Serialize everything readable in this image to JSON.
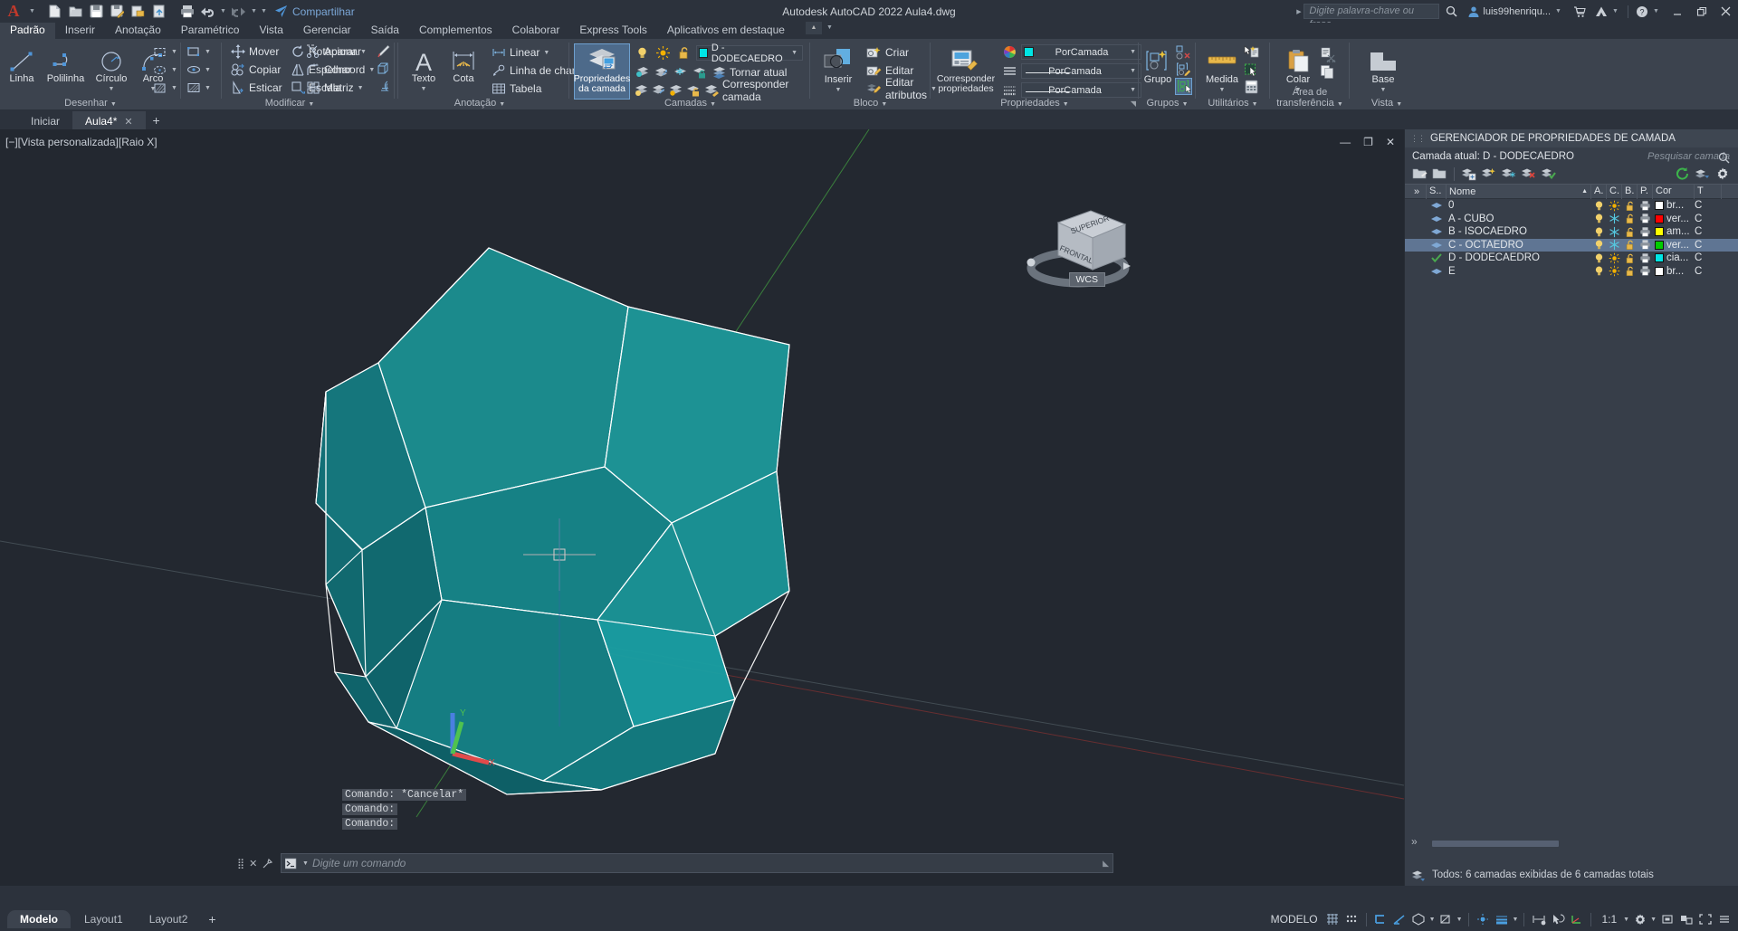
{
  "titlebar": {
    "app_logo": "autodesk-a-logo",
    "quick_access": [
      "new-icon",
      "open-icon",
      "save-icon",
      "save-as-icon",
      "plot-preview-icon",
      "publish-icon",
      "print-icon",
      "undo-icon",
      "redo-icon",
      "customize-icon"
    ],
    "share_label": "Compartilhar",
    "title": "Autodesk AutoCAD 2022    Aula4.dwg",
    "search_placeholder": "Digite palavra-chave ou frase",
    "user_label": "luis99henriqu...",
    "window_buttons": [
      "minimize",
      "restore",
      "close"
    ]
  },
  "ribbon_tabs": [
    {
      "label": "Padrão",
      "active": true
    },
    {
      "label": "Inserir",
      "active": false
    },
    {
      "label": "Anotação",
      "active": false
    },
    {
      "label": "Paramétrico",
      "active": false
    },
    {
      "label": "Vista",
      "active": false
    },
    {
      "label": "Gerenciar",
      "active": false
    },
    {
      "label": "Saída",
      "active": false
    },
    {
      "label": "Complementos",
      "active": false
    },
    {
      "label": "Colaborar",
      "active": false
    },
    {
      "label": "Express Tools",
      "active": false
    },
    {
      "label": "Aplicativos em destaque",
      "active": false
    }
  ],
  "ribbon": {
    "desenhar": {
      "title": "Desenhar",
      "big": [
        {
          "label": "Linha",
          "icon": "line-icon"
        },
        {
          "label": "Polilinha",
          "icon": "polyline-icon"
        },
        {
          "label": "Círculo",
          "icon": "circle-icon",
          "dropdown": true
        },
        {
          "label": "Arco",
          "icon": "arc-icon",
          "dropdown": true
        }
      ],
      "small": [
        "rectangle-icon",
        "ellipse-icon",
        "hatch-icon"
      ]
    },
    "modificar": {
      "title": "Modificar",
      "col1": [
        {
          "label": "Mover",
          "icon": "move-icon"
        },
        {
          "label": "Copiar",
          "icon": "copy-icon"
        },
        {
          "label": "Esticar",
          "icon": "stretch-icon"
        }
      ],
      "col2": [
        {
          "label": "Rotacionar",
          "icon": "rotate-icon"
        },
        {
          "label": "Espelhar",
          "icon": "mirror-icon"
        },
        {
          "label": "Escala",
          "icon": "scale-icon"
        }
      ],
      "col3": [
        {
          "label": "Aparar",
          "icon": "trim-icon",
          "dropdown": true
        },
        {
          "label": "Concord",
          "icon": "fillet-icon",
          "dropdown": true
        },
        {
          "label": "Matriz",
          "icon": "array-icon",
          "dropdown": true
        }
      ],
      "col4": [
        "erase-icon",
        "explode-icon",
        "offset-icon"
      ]
    },
    "anotacao": {
      "title": "Anotação",
      "big": [
        {
          "label": "Texto",
          "icon": "text-icon",
          "dropdown": true
        },
        {
          "label": "Cota",
          "icon": "dimension-icon"
        }
      ],
      "rows": [
        {
          "label": "Linear",
          "icon": "linear-dim-icon",
          "dropdown": true
        },
        {
          "label": "Linha de chamada",
          "icon": "leader-icon",
          "dropdown": true
        },
        {
          "label": "Tabela",
          "icon": "table-icon"
        }
      ]
    },
    "camadas": {
      "title": "Camadas",
      "big": {
        "label_line1": "Propriedades",
        "label_line2": "da camada",
        "icon": "layer-properties-icon",
        "active": true
      },
      "layer_combo": {
        "value": "D - DODECAEDRO",
        "color": "#00e5e5"
      },
      "state_icons": [
        "bulb-on-icon",
        "sun-icon",
        "unlock-icon"
      ],
      "row2_icons": [
        "layer-isolate-icon",
        "layer-unisolate-icon",
        "layer-freeze-icon",
        "layer-lock-icon"
      ],
      "row3_icons": [
        "layer-off-icon",
        "layer-turn-all-on-icon",
        "layer-thaw-icon",
        "layer-unlock-icon"
      ],
      "make_current": "Tornar atual",
      "match_layer": "Corresponder camada"
    },
    "bloco": {
      "title": "Bloco",
      "big": {
        "label": "Inserir",
        "icon": "insert-block-icon",
        "dropdown": true
      },
      "rows": [
        {
          "label": "Criar",
          "icon": "create-block-icon"
        },
        {
          "label": "Editar",
          "icon": "edit-block-icon"
        },
        {
          "label": "Editar atributos",
          "icon": "edit-attributes-icon",
          "dropdown": true
        }
      ]
    },
    "propriedades": {
      "title": "Propriedades",
      "big": {
        "label_line1": "Corresponder",
        "label_line2": "propriedades",
        "icon": "match-properties-icon"
      },
      "combos": [
        {
          "value": "PorCamada",
          "icon": "color-wheel-icon",
          "swatch": "#00e5e5"
        },
        {
          "value": "PorCamada",
          "icon": "linetype-icon",
          "line": true
        },
        {
          "value": "PorCamada",
          "icon": "lineweight-icon",
          "line": true
        }
      ]
    },
    "grupos": {
      "title": "Grupos",
      "big": {
        "label": "Grupo",
        "icon": "group-icon",
        "dropdown": true
      },
      "small": [
        "ungroup-icon",
        "edit-group-icon",
        "group-selection-on-icon"
      ]
    },
    "utilitarios": {
      "title": "Utilitários",
      "big": {
        "label": "Medida",
        "icon": "measure-icon",
        "dropdown": true
      },
      "small": [
        "quick-select-icon",
        "quick-calc-area-icon",
        "calculator-icon"
      ]
    },
    "area_transferencia": {
      "title": "Área de transferência",
      "big": {
        "label": "Colar",
        "icon": "paste-icon",
        "dropdown": true
      },
      "small": [
        "cut-icon",
        "copy-clip-icon"
      ]
    },
    "vista": {
      "title": "Vista",
      "big": {
        "label": "Base",
        "icon": "base-view-icon",
        "dropdown": true
      }
    }
  },
  "doctabs": [
    {
      "label": "Iniciar",
      "active": false,
      "closable": false
    },
    {
      "label": "Aula4*",
      "active": true,
      "closable": true
    }
  ],
  "canvas": {
    "viewport_label": "[−][Vista personalizada][Raio X]",
    "viewcube_labels": {
      "top": "SUPERIOR",
      "front": "FRONTAL",
      "wcs": "WCS"
    },
    "command_history": [
      "Comando: *Cancelar*",
      "Comando:",
      "Comando:"
    ],
    "command_placeholder": "Digite um comando",
    "model_colors": {
      "face_light": "#18898c",
      "face_mid": "#157f84",
      "face_dark": "#116d74",
      "edge": "#ffffff"
    },
    "axis_colors": {
      "x": "#e04a4a",
      "y": "#4fc24f",
      "z": "#4a7fe0"
    }
  },
  "palette": {
    "title": "GERENCIADOR DE PROPRIEDADES DE CAMADA",
    "current_layer_label": "Camada atual: D - DODECAEDRO",
    "search_placeholder": "Pesquisar camada",
    "toolbar_icons": [
      "new-layer-icon",
      "new-group-filter-icon",
      "layer-states-icon",
      "new-layer-vp-frozen-icon",
      "delete-layer-icon",
      "set-current-icon"
    ],
    "toolbar_right_icons": [
      "refresh-icon",
      "layer-settings-icon",
      "settings-gear-icon"
    ],
    "columns": [
      "S..",
      "Nome",
      "A.",
      "C.",
      "B.",
      "P.",
      "Cor",
      "T"
    ],
    "rows": [
      {
        "status": "layer-icon",
        "name": "0",
        "on": "bulb-on-icon",
        "freeze": "sun-icon",
        "lock": "unlock-icon",
        "plot": "plot-icon",
        "color_swatch": "#ffffff",
        "color_name": "br..."
      },
      {
        "status": "layer-icon",
        "name": "A - CUBO",
        "on": "bulb-on-icon",
        "freeze": "snowflake-icon",
        "lock": "unlock-icon",
        "plot": "plot-icon",
        "color_swatch": "#ff0000",
        "color_name": "ver..."
      },
      {
        "status": "layer-icon",
        "name": "B - ISOCAEDRO",
        "on": "bulb-on-icon",
        "freeze": "snowflake-icon",
        "lock": "unlock-icon",
        "plot": "plot-icon",
        "color_swatch": "#ffff00",
        "color_name": "am..."
      },
      {
        "status": "layer-icon",
        "name": "C - OCTAEDRO",
        "on": "bulb-on-icon",
        "freeze": "snowflake-icon",
        "lock": "unlock-icon",
        "plot": "plot-icon",
        "color_swatch": "#00cc00",
        "color_name": "ver...",
        "selected": true
      },
      {
        "status": "current-check-icon",
        "name": "D - DODECAEDRO",
        "on": "bulb-on-icon",
        "freeze": "sun-icon",
        "lock": "unlock-icon",
        "plot": "plot-icon",
        "color_swatch": "#00e5e5",
        "color_name": "cia..."
      },
      {
        "status": "layer-icon",
        "name": "E",
        "on": "bulb-on-icon",
        "freeze": "sun-icon",
        "lock": "unlock-icon",
        "plot": "plot-icon",
        "color_swatch": "#ffffff",
        "color_name": "br..."
      }
    ],
    "status_text": "Todos: 6 camadas exibidas de 6 camadas totais"
  },
  "statusbar": {
    "layout_tabs": [
      {
        "label": "Modelo",
        "active": true
      },
      {
        "label": "Layout1",
        "active": false
      },
      {
        "label": "Layout2",
        "active": false
      }
    ],
    "add_layout": "+",
    "model_label": "MODELO",
    "scale_label": "1:1",
    "icons": [
      "grid-icon",
      "snap-icon",
      "ortho-icon",
      "polar-icon",
      "osnap-icon",
      "otrack-icon",
      "lineweight-icon",
      "transparency-icon",
      "selection-cycling-icon",
      "annotation-monitor-icon",
      "dynamic-ucs-icon",
      "annotation-scale-icon",
      "workspace-icon",
      "customization-icon",
      "hardware-accel-icon",
      "isolate-objects-icon",
      "fullscreen-icon",
      "menu-icon"
    ]
  }
}
